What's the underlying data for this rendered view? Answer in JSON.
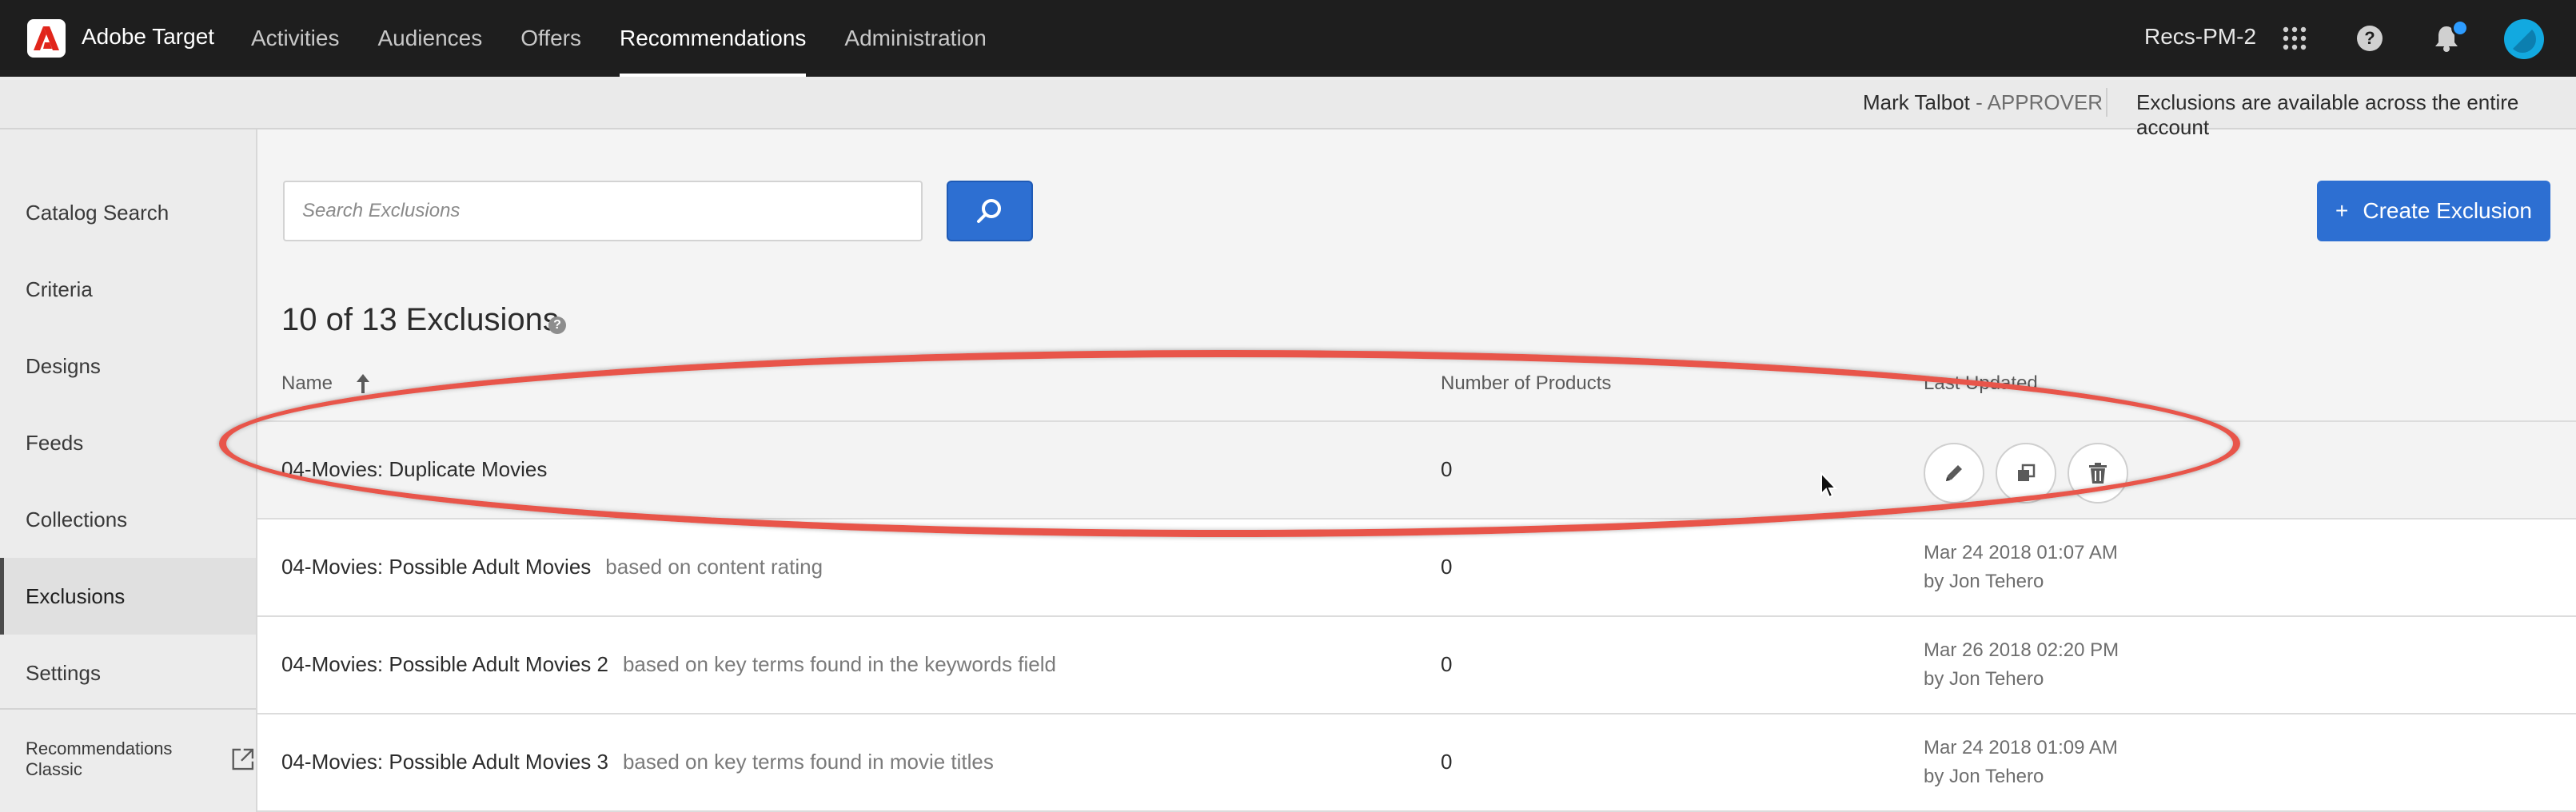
{
  "app": {
    "name": "Adobe Target",
    "logo": "adobe-logo"
  },
  "nav": {
    "items": [
      {
        "label": "Activities",
        "active": false
      },
      {
        "label": "Audiences",
        "active": false
      },
      {
        "label": "Offers",
        "active": false
      },
      {
        "label": "Recommendations",
        "active": true
      },
      {
        "label": "Administration",
        "active": false
      }
    ]
  },
  "topbar": {
    "account": "Recs-PM-2",
    "icons": [
      "apps-grid-icon",
      "help-icon",
      "bell-icon",
      "avatar"
    ]
  },
  "subbar": {
    "user": "Mark Talbot",
    "separator": " - ",
    "role": "APPROVER",
    "note": "Exclusions are available across the entire account"
  },
  "sidebar": {
    "items": [
      {
        "label": "Catalog Search",
        "active": false
      },
      {
        "label": "Criteria",
        "active": false
      },
      {
        "label": "Designs",
        "active": false
      },
      {
        "label": "Feeds",
        "active": false
      },
      {
        "label": "Collections",
        "active": false
      },
      {
        "label": "Exclusions",
        "active": true
      },
      {
        "label": "Settings",
        "active": false
      }
    ],
    "classic_link": "Recommendations Classic"
  },
  "search": {
    "placeholder": "Search Exclusions",
    "value": ""
  },
  "create_button": {
    "label": "Create Exclusion",
    "icon": "+"
  },
  "list": {
    "count_title": "10 of 13 Exclusions",
    "info_icon": "?",
    "columns": {
      "name": "Name",
      "products": "Number of Products",
      "updated": "Last Updated"
    },
    "rows": [
      {
        "name": "04-Movies: Duplicate Movies",
        "description": "",
        "products": "0",
        "updated_date": "",
        "updated_by": "",
        "hover": true
      },
      {
        "name": "04-Movies: Possible Adult Movies",
        "description": "based on content rating",
        "products": "0",
        "updated_date": "Mar 24 2018 01:07 AM",
        "updated_by": "by Jon Tehero"
      },
      {
        "name": "04-Movies: Possible Adult Movies 2",
        "description": "based on key terms found in the keywords field",
        "products": "0",
        "updated_date": "Mar 26 2018 02:20 PM",
        "updated_by": "by Jon Tehero"
      },
      {
        "name": "04-Movies: Possible Adult Movies 3",
        "description": "based on key terms found in movie titles",
        "products": "0",
        "updated_date": "Mar 24 2018 01:09 AM",
        "updated_by": "by Jon Tehero"
      }
    ]
  },
  "colors": {
    "brand_blue": "#2d6fd2",
    "topbar": "#1e1e1e",
    "highlight": "#e8554a",
    "notification": "#2d9cff"
  }
}
